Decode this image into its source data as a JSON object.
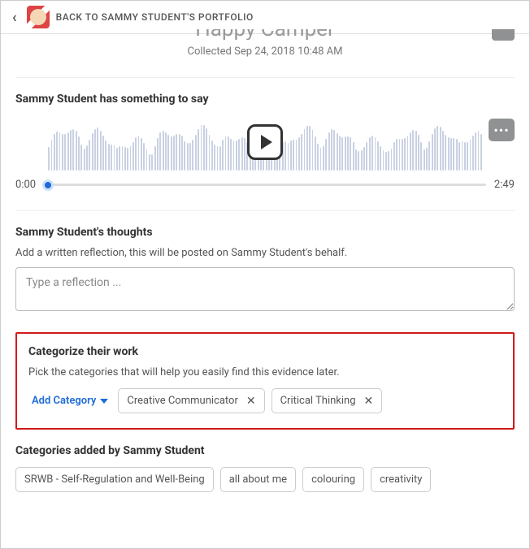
{
  "header": {
    "back_text": "BACK TO SAMMY STUDENT'S PORTFOLIO"
  },
  "item": {
    "title": "Happy Camper",
    "collected_label": "Collected",
    "collected_date": "Sep 24, 2018 10:48 AM"
  },
  "audio": {
    "heading": "Sammy Student has something to say",
    "start_time": "0:00",
    "end_time": "2:49",
    "more_label": "•••"
  },
  "thoughts": {
    "heading": "Sammy Student's thoughts",
    "sub": "Add a written reflection, this will be posted on Sammy Student's behalf.",
    "placeholder": "Type a reflection ..."
  },
  "categorize": {
    "heading": "Categorize their work",
    "sub": "Pick the categories that will help you easily find this evidence later.",
    "add_label": "Add Category",
    "chips": [
      "Creative Communicator",
      "Critical Thinking"
    ]
  },
  "student_categories": {
    "heading": "Categories added by Sammy Student",
    "chips": [
      "SRWB - Self-Regulation and Well-Being",
      "all about me",
      "colouring",
      "creativity"
    ]
  }
}
